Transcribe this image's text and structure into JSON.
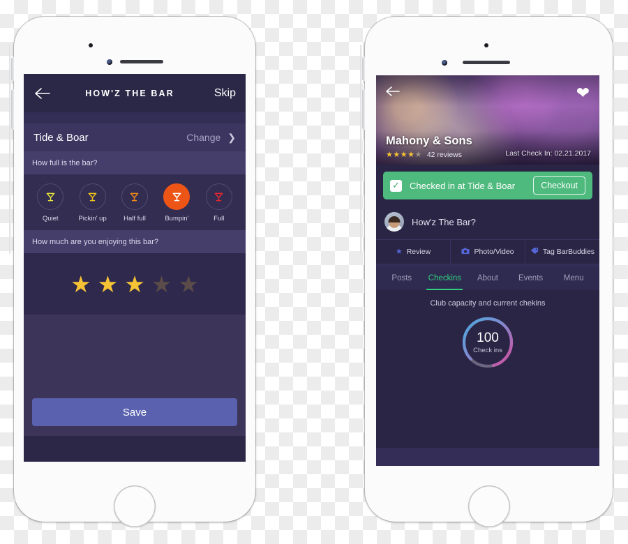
{
  "phone1": {
    "header": {
      "back_icon": "arrow-left-icon",
      "title": "HOW'Z THE BAR",
      "skip_label": "Skip"
    },
    "venue_row": {
      "venue_name": "Tide & Boar",
      "change_label": "Change",
      "chevron_icon": "chevron-right-icon"
    },
    "fullness": {
      "question": "How full is the bar?",
      "options": [
        {
          "label": "Quiet",
          "icon": "martini-glass-icon",
          "color": "#e8e53a",
          "selected": false
        },
        {
          "label": "Pickin' up",
          "icon": "martini-glass-icon",
          "color": "#f2c517",
          "selected": false
        },
        {
          "label": "Half full",
          "icon": "martini-glass-icon",
          "color": "#f08a16",
          "selected": false
        },
        {
          "label": "Bumpin'",
          "icon": "martini-glass-icon",
          "color": "#ffffff",
          "selected": true
        },
        {
          "label": "Full",
          "icon": "martini-glass-icon",
          "color": "#e8282d",
          "selected": false
        }
      ],
      "selected_index": 3,
      "selected_bg": "#ed5517"
    },
    "rating": {
      "question": "How much are you enjoying this bar?",
      "value": 3,
      "max": 5,
      "filled_color": "#f6c334",
      "empty_color": "#5b4b49"
    },
    "save_label": "Save",
    "save_color": "#5a62b0"
  },
  "phone2": {
    "hero": {
      "back_icon": "arrow-left-icon",
      "favorite_icon": "heart-icon",
      "venue_name": "Mahony & Sons",
      "stars_value": 4,
      "stars_max": 5,
      "reviews_text": "42 reviews",
      "last_checkin": "Last Check In: 02.21.2017"
    },
    "checkin_banner": {
      "check_icon": "checkbox-checked-icon",
      "text": "Checked in at Tide & Boar",
      "button_label": "Checkout",
      "color": "#4fba7e"
    },
    "prompt": {
      "avatar": "user-avatar",
      "text": "How'z The Bar?"
    },
    "actions": [
      {
        "label": "Review",
        "icon": "star-icon"
      },
      {
        "label": "Photo/Video",
        "icon": "camera-icon"
      },
      {
        "label": "Tag BarBuddies",
        "icon": "tag-icon"
      }
    ],
    "tabs": [
      {
        "label": "Posts",
        "active": false
      },
      {
        "label": "Checkins",
        "active": true
      },
      {
        "label": "About",
        "active": false
      },
      {
        "label": "Events",
        "active": false
      },
      {
        "label": "Menu",
        "active": false
      }
    ],
    "active_tab_color": "#2fd07e",
    "capacity": {
      "caption": "Club capacity and current chekins",
      "value": "100",
      "label": "Check ins",
      "arc_start_color": "#4aa8e0",
      "arc_end_color": "#d94a9e",
      "track_color": "#6b657f"
    }
  }
}
